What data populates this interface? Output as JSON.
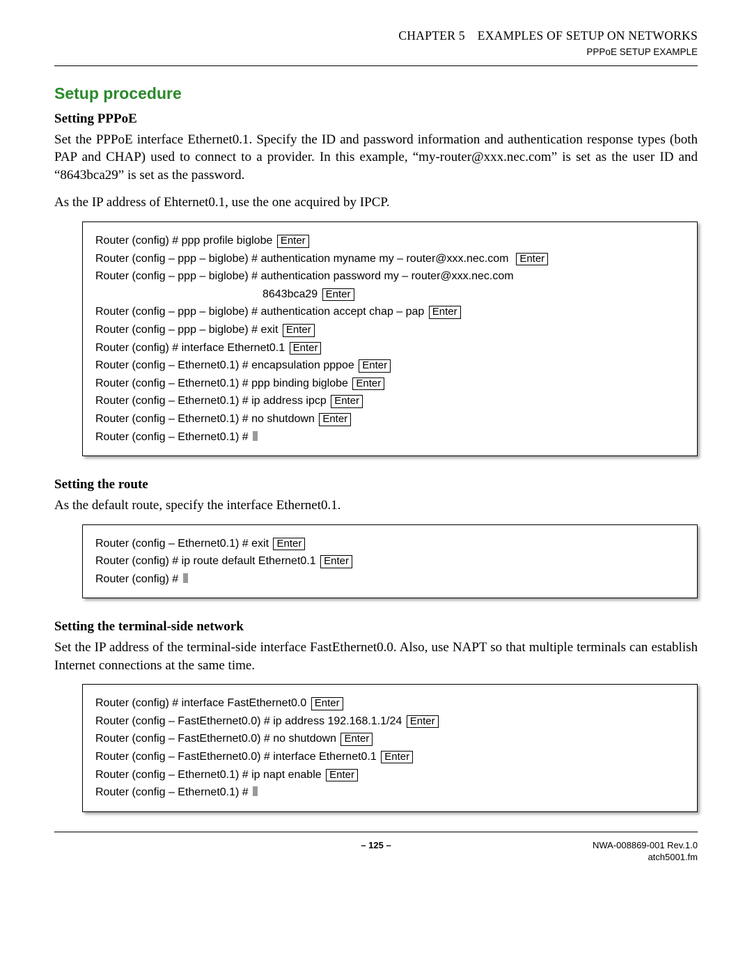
{
  "header": {
    "chapter": "CHAPTER 5 EXAMPLES OF SETUP ON NETWORKS",
    "sub": "PPPoE SETUP EXAMPLE"
  },
  "mainHeading": "Setup procedure",
  "enterLabel": "Enter",
  "section1": {
    "heading": "Setting PPPoE",
    "p1": "Set the PPPoE interface Ethernet0.1. Specify the ID and password information and authentication response types (both PAP and CHAP) used to connect to a provider. In this example, “my-router@xxx.nec.com” is set as the user ID and “8643bca29” is set as the password.",
    "p2": "As the IP address of Ehternet0.1, use the one acquired by IPCP.",
    "lines": {
      "l1": "Router (config) # ppp profile biglobe",
      "l2": "Router (config – ppp – biglobe) # authentication myname my – router@xxx.nec.com",
      "l3": "Router (config – ppp – biglobe) # authentication password my – router@xxx.nec.com",
      "l3b": "8643bca29",
      "l4": "Router (config – ppp – biglobe) # authentication accept chap – pap",
      "l5": "Router (config – ppp – biglobe) # exit",
      "l6": "Router (config) # interface Ethernet0.1",
      "l7": "Router (config – Ethernet0.1) # encapsulation pppoe",
      "l8": "Router (config – Ethernet0.1) # ppp binding biglobe",
      "l9": "Router (config – Ethernet0.1) # ip address ipcp",
      "l10": "Router (config – Ethernet0.1) # no shutdown",
      "l11": "Router (config – Ethernet0.1) # "
    }
  },
  "section2": {
    "heading": "Setting the route",
    "p1": "As the default route, specify the interface Ethernet0.1.",
    "lines": {
      "l1": "Router (config – Ethernet0.1) # exit",
      "l2": "Router (config) # ip route default Ethernet0.1",
      "l3": "Router (config) # "
    }
  },
  "section3": {
    "heading": "Setting the terminal-side network",
    "p1": "Set the IP address of the terminal-side interface FastEthernet0.0. Also, use NAPT so that multiple terminals can establish Internet connections at the same time.",
    "lines": {
      "l1": "Router (config) # interface FastEthernet0.0",
      "l2": "Router (config – FastEthernet0.0) # ip address 192.168.1.1/24",
      "l3": "Router (config – FastEthernet0.0) # no shutdown",
      "l4": "Router (config – FastEthernet0.0) # interface Ethernet0.1",
      "l5": "Router (config – Ethernet0.1) # ip napt enable",
      "l6": "Router (config – Ethernet0.1) # "
    }
  },
  "footer": {
    "page": "– 125 –",
    "doc1": "NWA-008869-001 Rev.1.0",
    "doc2": "atch5001.fm"
  }
}
